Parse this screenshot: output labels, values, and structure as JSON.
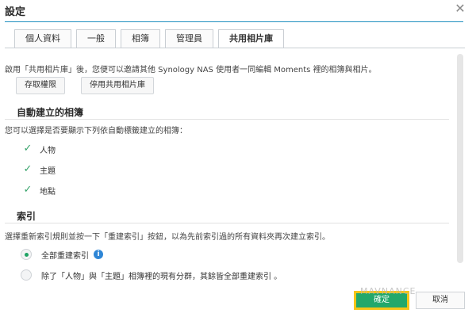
{
  "window": {
    "title": "設定"
  },
  "tabs": [
    "個人資料",
    "一般",
    "相簿",
    "管理員",
    "共用相片庫"
  ],
  "content": {
    "intro": "啟用「共用相片庫」後，您便可以邀請其他 Synology NAS 使用者一同編輯 Moments 裡的相簿與相片。",
    "buttons": {
      "access": "存取權限",
      "disable": "停用共用相片庫"
    },
    "auto_album": {
      "title": "自動建立的相簿",
      "desc": "您可以選擇是否要顯示下列依自動標籤建立的相簿：",
      "items": [
        {
          "label": "人物",
          "checked": true
        },
        {
          "label": "主題",
          "checked": true
        },
        {
          "label": "地點",
          "checked": true
        }
      ]
    },
    "index": {
      "title": "索引",
      "desc": "選擇重新索引規則並按一下「重建索引」按鈕，以為先前索引過的所有資料夾再次建立索引。",
      "options": [
        {
          "label": "全部重建索引",
          "selected": true
        },
        {
          "label": "除了「人物」與「主題」相簿裡的現有分群，其餘皆全部重建索引 。",
          "selected": false
        }
      ]
    }
  },
  "footer": {
    "ok": "確定",
    "cancel": "取消"
  },
  "watermark": "MAVNANCE"
}
